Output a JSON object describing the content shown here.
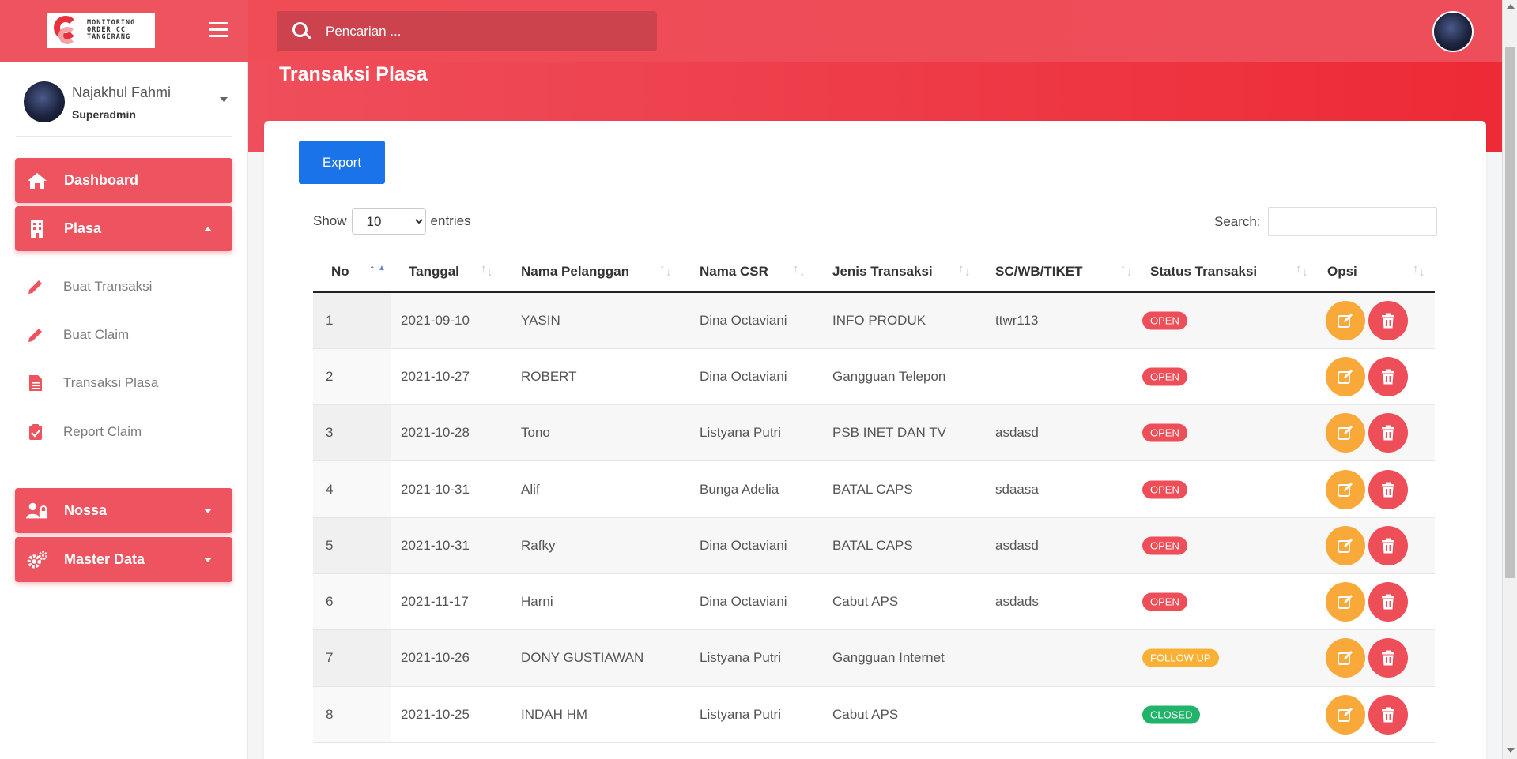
{
  "brand": {
    "logo_lines": [
      "MONITORING",
      "ORDER CC",
      "TANGERANG"
    ]
  },
  "search": {
    "placeholder": "Pencarian ..."
  },
  "page": {
    "title": "Transaksi Plasa"
  },
  "sidebar": {
    "user": {
      "name": "Najakhul Fahmi",
      "role": "Superadmin"
    },
    "items": [
      {
        "label": "Dashboard",
        "icon": "home-icon"
      },
      {
        "label": "Plasa",
        "icon": "building-icon"
      },
      {
        "label": "Nossa",
        "icon": "users-lock-icon"
      },
      {
        "label": "Master Data",
        "icon": "gears-icon"
      }
    ],
    "subitems": [
      {
        "label": "Buat Transaksi",
        "icon": "pencil-icon"
      },
      {
        "label": "Buat Claim",
        "icon": "pencil-icon"
      },
      {
        "label": "Transaksi Plasa",
        "icon": "file-icon"
      },
      {
        "label": "Report Claim",
        "icon": "clipboard-check-icon"
      }
    ]
  },
  "toolbar": {
    "export_label": "Export"
  },
  "datatable": {
    "show_label": "Show",
    "entries_label": "entries",
    "page_length": "10",
    "search_label": "Search:",
    "columns": [
      "No",
      "Tanggal",
      "Nama Pelanggan",
      "Nama CSR",
      "Jenis Transaksi",
      "SC/WB/TIKET",
      "Status Transaksi",
      "Opsi"
    ],
    "rows": [
      {
        "no": "1",
        "tanggal": "2021-09-10",
        "pelanggan": "YASIN",
        "csr": "Dina Octaviani",
        "jenis": "INFO PRODUK",
        "tiket": "ttwr113",
        "status": "OPEN"
      },
      {
        "no": "2",
        "tanggal": "2021-10-27",
        "pelanggan": "ROBERT",
        "csr": "Dina Octaviani",
        "jenis": "Gangguan Telepon",
        "tiket": "",
        "status": "OPEN"
      },
      {
        "no": "3",
        "tanggal": "2021-10-28",
        "pelanggan": "Tono",
        "csr": "Listyana Putri",
        "jenis": "PSB INET DAN TV",
        "tiket": "asdasd",
        "status": "OPEN"
      },
      {
        "no": "4",
        "tanggal": "2021-10-31",
        "pelanggan": "Alif",
        "csr": "Bunga Adelia",
        "jenis": "BATAL CAPS",
        "tiket": "sdaasa",
        "status": "OPEN"
      },
      {
        "no": "5",
        "tanggal": "2021-10-31",
        "pelanggan": "Rafky",
        "csr": "Dina Octaviani",
        "jenis": "BATAL CAPS",
        "tiket": "asdasd",
        "status": "OPEN"
      },
      {
        "no": "6",
        "tanggal": "2021-11-17",
        "pelanggan": "Harni",
        "csr": "Dina Octaviani",
        "jenis": "Cabut APS",
        "tiket": "asdads",
        "status": "OPEN"
      },
      {
        "no": "7",
        "tanggal": "2021-10-26",
        "pelanggan": "DONY GUSTIAWAN",
        "csr": "Listyana Putri",
        "jenis": "Gangguan Internet",
        "tiket": "",
        "status": "FOLLOW UP"
      },
      {
        "no": "8",
        "tanggal": "2021-10-25",
        "pelanggan": "INDAH HM",
        "csr": "Listyana Putri",
        "jenis": "Cabut APS",
        "tiket": "",
        "status": "CLOSED"
      }
    ]
  },
  "colors": {
    "primary": "#ee5460",
    "export": "#1a73e8",
    "edit": "#f9a93a",
    "delete": "#ee4e58",
    "status_open": "#ee4e58",
    "status_follow_up": "#f9b035",
    "status_closed": "#21b36a"
  }
}
